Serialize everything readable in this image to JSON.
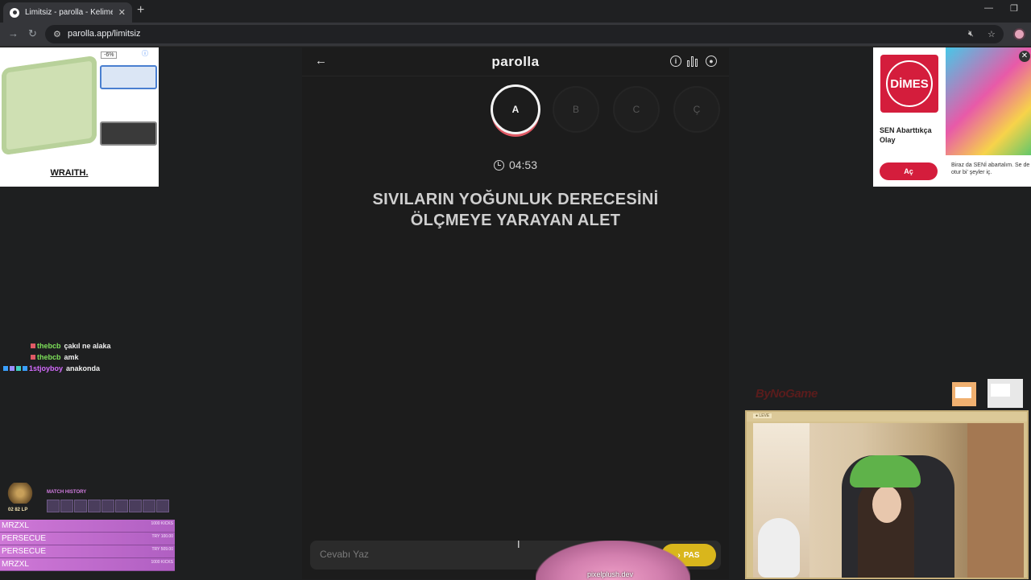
{
  "browser": {
    "tab_title": "Limitsiz - parolla - Kelime oyunu",
    "tab_close": "✕",
    "new_tab": "+",
    "url": "parolla.app/limitsiz"
  },
  "game": {
    "logo": "parolla",
    "letters": [
      "A",
      "B",
      "C",
      "Ç"
    ],
    "active_letter_index": 0,
    "timer": "04:53",
    "question_line1": "SIVILARIN YOĞUNLUK DERECESİNİ",
    "question_line2": "ÖLÇMEYE YARAYAN ALET",
    "answer_placeholder": "Cevabı Yaz",
    "pass_label": "PAS",
    "plush_label": "pixelplush.dev"
  },
  "ads": {
    "left_discount": "-6%",
    "left_brand": "WRAITH.",
    "right_brand": "DİMES",
    "right_title": "SEN Abarttıkça Olay",
    "right_cta": "Aç",
    "right_text": "Biraz da SENİ abartalım. Se de otur bi' şeyler iç."
  },
  "stream": {
    "chat": [
      {
        "user": "thebcb",
        "message": "çakıl ne alaka",
        "color": "#7ee15a"
      },
      {
        "user": "thebcb",
        "message": "amk",
        "color": "#7ee15a"
      },
      {
        "user": "1stjoyboy",
        "message": "anakonda",
        "color": "#d56bff"
      }
    ],
    "rank_lp": "02 82 LP",
    "match_history_label": "MATCH HISTORY",
    "subs": [
      {
        "name": "MRZXL",
        "amount": "1000 KICKS"
      },
      {
        "name": "PERSECUE",
        "amount": "TRY 100.00"
      },
      {
        "name": "PERSECUE",
        "amount": "TRY 509.00"
      },
      {
        "name": "MRZXL",
        "amount": "1000 KICKS"
      }
    ],
    "sponsor": "ByNoGame",
    "cam_tag": "● LEVE"
  }
}
